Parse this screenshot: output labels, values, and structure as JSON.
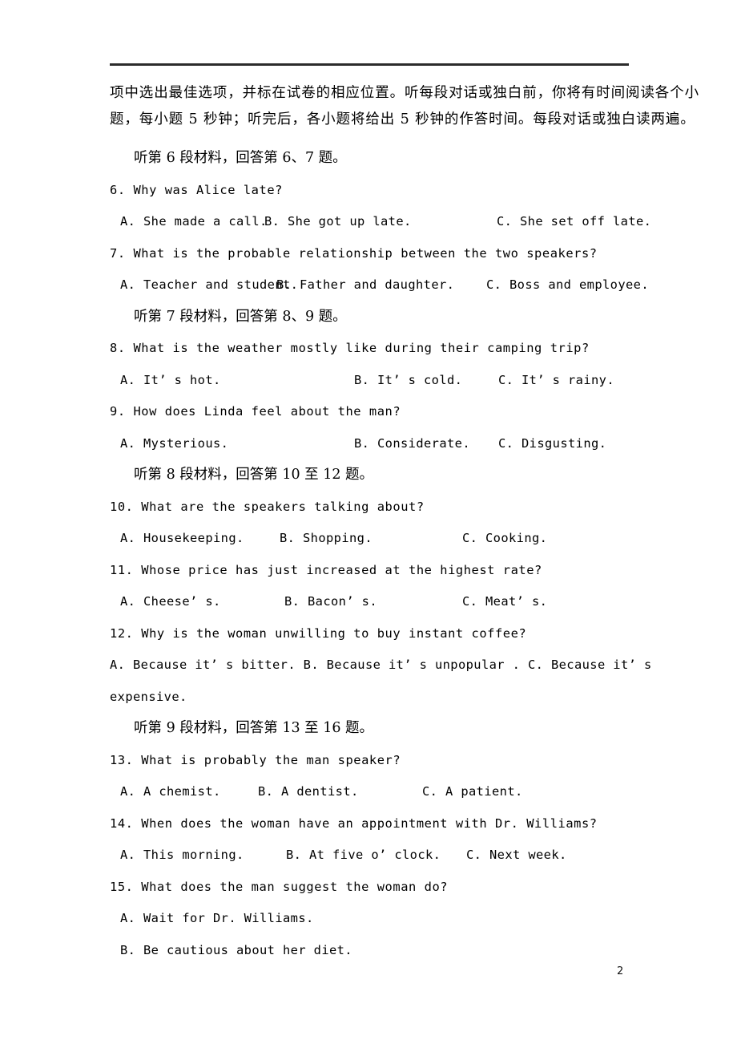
{
  "page": {
    "number": "2",
    "rule": true
  },
  "instructions": {
    "line1": "项中选出最佳选项，并标在试卷的相应位置。听每段对话或独白前，你将有时间阅读各个小",
    "line2": "题，每小题 5 秒钟；听完后，各小题将给出 5 秒钟的作答时间。每段对话或独白读两遍。"
  },
  "sections": [
    {
      "id": "sec6",
      "heading": "听第 6 段材料，回答第 6、7 题。"
    },
    {
      "id": "sec7",
      "heading": "听第 7 段材料，回答第 8、9 题。"
    },
    {
      "id": "sec8",
      "heading": "听第 8 段材料，回答第 10 至 12 题。"
    },
    {
      "id": "sec9",
      "heading": "听第 9 段材料，回答第 13 至 16 题。"
    }
  ],
  "questions": [
    {
      "number": "6.",
      "stem": "6.  Why was Alice late?",
      "options": {
        "a": "A. She made a call.",
        "b": "B. She got up late.",
        "c": "C. She set off late."
      }
    },
    {
      "number": "7.",
      "stem": "7. What is the probable relationship between the two speakers?",
      "options": {
        "a": "A. Teacher and student.",
        "b": "B. Father and daughter.",
        "c": "C. Boss and employee."
      }
    },
    {
      "number": "8.",
      "stem": "8.  What is the weather mostly like during their camping trip?",
      "options": {
        "a": "A. It’ s hot.",
        "b": "B. It’ s cold.",
        "c": "C. It’ s rainy."
      }
    },
    {
      "number": "9.",
      "stem": "9. How does Linda feel about the man?",
      "options": {
        "a": "A. Mysterious.",
        "b": "B. Considerate.",
        "c": "C. Disgusting."
      }
    },
    {
      "number": "10.",
      "stem": "10. What are the speakers talking about?",
      "options": {
        "a": "A. Housekeeping.",
        "b": "B. Shopping.",
        "c": "C. Cooking."
      }
    },
    {
      "number": "11.",
      "stem": "11. Whose price has just increased at the highest rate?",
      "options": {
        "a": "A. Cheese’ s.",
        "b": "B. Bacon’ s.",
        "c": "C. Meat’ s."
      }
    },
    {
      "number": "12.",
      "stem": "12. Why is the woman unwilling to buy instant coffee?",
      "options_inline": " A. Because it’ s bitter.   B. Because it’ s unpopular .   C. Because it’ s",
      "options_inline_cont": "expensive."
    },
    {
      "number": "13.",
      "stem": "13. What is probably the man speaker?",
      "options": {
        "a": "A. A chemist.",
        "b": "B. A dentist.",
        "c": "C. A patient."
      }
    },
    {
      "number": "14.",
      "stem": "14. When does the woman have an appointment with Dr. Williams?",
      "options": {
        "a": "A. This morning.",
        "b": "B. At five o’ clock.",
        "c": "C. Next week."
      }
    },
    {
      "number": "15.",
      "stem": "15. What does the man suggest the woman do?",
      "options_stacked": [
        "A. Wait for Dr. Williams.",
        "B. Be cautious about her diet."
      ]
    }
  ]
}
